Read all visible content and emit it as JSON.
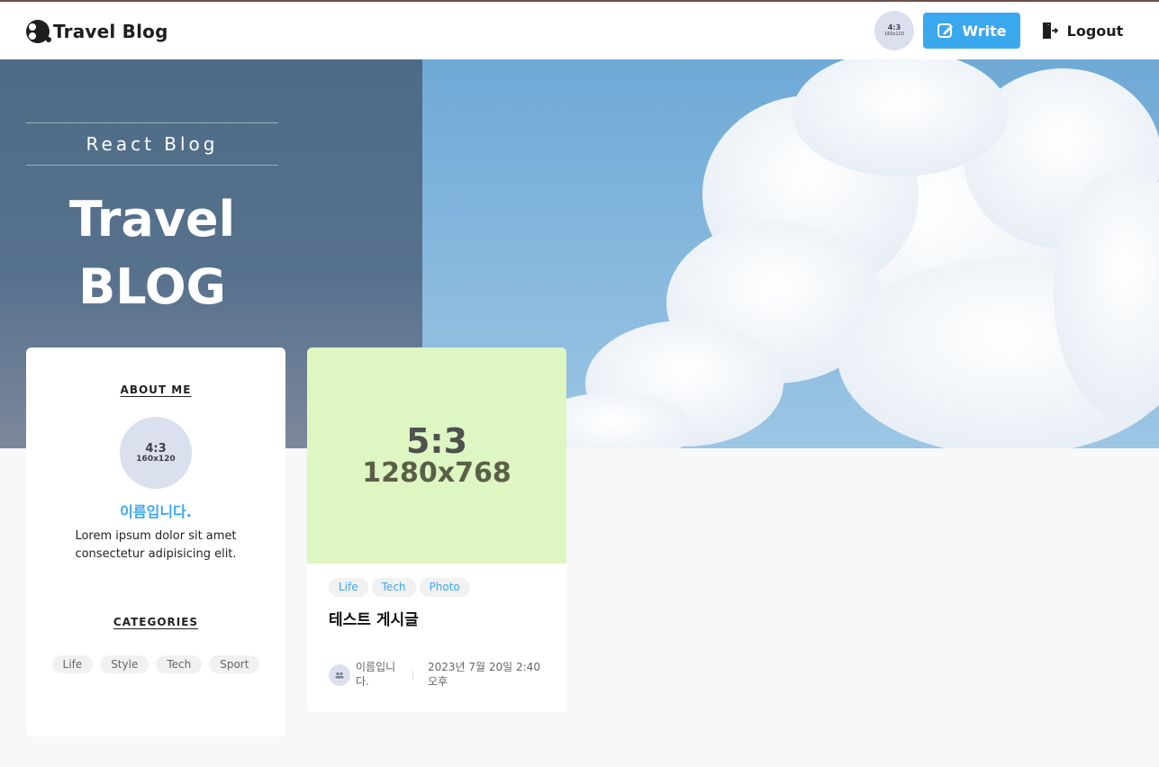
{
  "header": {
    "logo_text": "Travel",
    "logo_text_2": "Blog",
    "avatar": {
      "ratio": "4:3",
      "size": "160x120"
    },
    "write_label": "Write",
    "logout_label": "Logout"
  },
  "hero": {
    "subtitle": "React Blog",
    "title_line1": "Travel",
    "title_line2": "BLOG"
  },
  "about": {
    "heading": "ABOUT ME",
    "avatar": {
      "ratio": "4:3",
      "size": "160x120"
    },
    "name": "이름입니다.",
    "description": "Lorem ipsum dolor sit amet consectetur adipisicing elit.",
    "categories_heading": "CATEGORIES",
    "categories": [
      "Life",
      "Style",
      "Tech",
      "Sport"
    ]
  },
  "post": {
    "image": {
      "ratio": "5:3",
      "size": "1280x768"
    },
    "tags": [
      "Life",
      "Tech",
      "Photo"
    ],
    "title": "테스트 게시글",
    "author": "이름입니다.",
    "date": "2023년 7월 20일 2:40 오후"
  },
  "colors": {
    "accent": "#3aa8ee",
    "hero_panel": "#4d6b87",
    "image_placeholder": "#def6c1",
    "avatar_placeholder": "#dbe0ee"
  }
}
